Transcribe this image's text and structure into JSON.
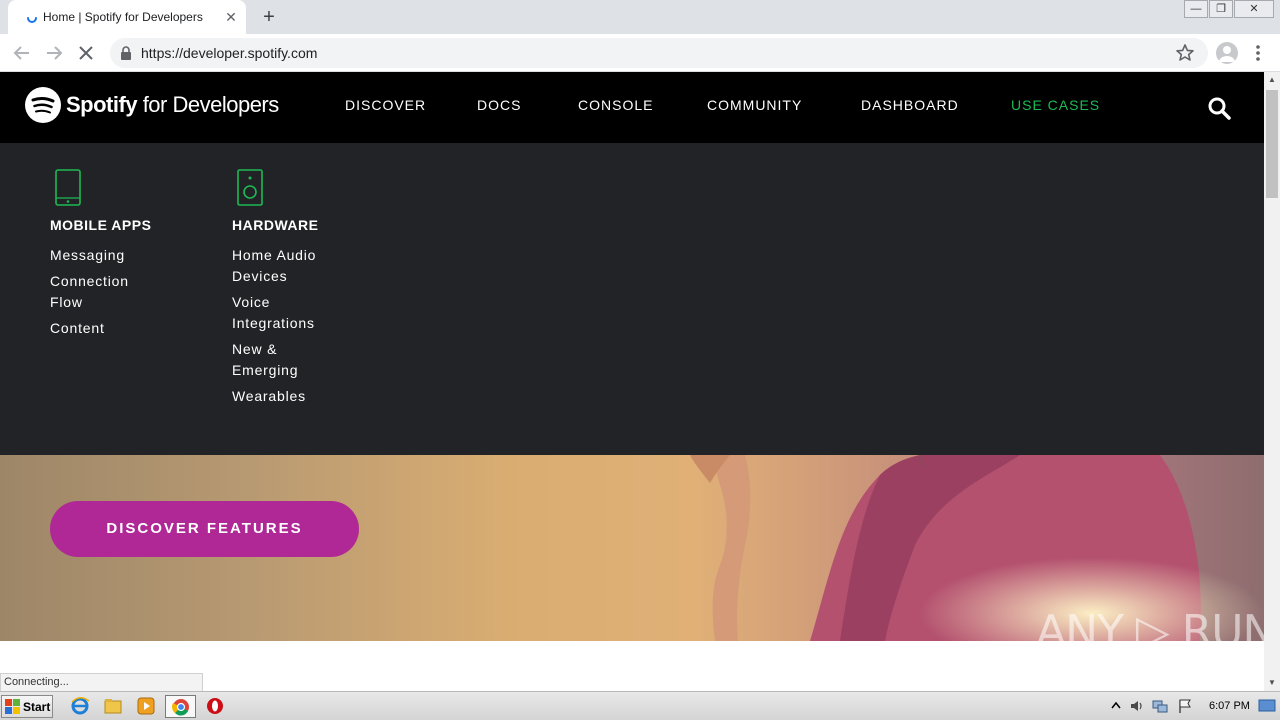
{
  "browser": {
    "tab": {
      "title": "Home | Spotify for Developers",
      "close": "✕"
    },
    "new_tab": "+",
    "window_controls": {
      "minimize": "—",
      "restore": "❐",
      "close": "✕"
    },
    "address": {
      "url": "https://developer.spotify.com"
    },
    "status": "Connecting..."
  },
  "site": {
    "logo": {
      "brand": "Spotify",
      "suffix": "for Developers"
    },
    "nav": [
      {
        "label": "DISCOVER",
        "active": false
      },
      {
        "label": "DOCS",
        "active": false
      },
      {
        "label": "CONSOLE",
        "active": false
      },
      {
        "label": "COMMUNITY",
        "active": false
      },
      {
        "label": "DASHBOARD",
        "active": false
      },
      {
        "label": "USE CASES",
        "active": true
      }
    ],
    "dropdown": {
      "columns": [
        {
          "title": "MOBILE APPS",
          "icon": "phone-icon",
          "links": [
            "Messaging",
            "Connection Flow",
            "Content"
          ]
        },
        {
          "title": "HARDWARE",
          "icon": "speaker-icon",
          "links": [
            "Home Audio Devices",
            "Voice Integrations",
            "New & Emerging",
            "Wearables"
          ]
        }
      ]
    },
    "hero": {
      "cta": "DISCOVER FEATURES"
    },
    "colors": {
      "accent": "#1db954",
      "cta": "#af2896",
      "header": "#000000",
      "dropdown": "#222326"
    }
  },
  "watermark": "ANY ▷ RUN",
  "taskbar": {
    "start": "Start",
    "pinned": [
      "ie-icon",
      "explorer-icon",
      "media-player-icon",
      "chrome-icon",
      "opera-icon"
    ],
    "tray": [
      "show-hidden-icon",
      "volume-icon",
      "network-icon",
      "flag-icon"
    ],
    "clock": "6:07 PM"
  }
}
